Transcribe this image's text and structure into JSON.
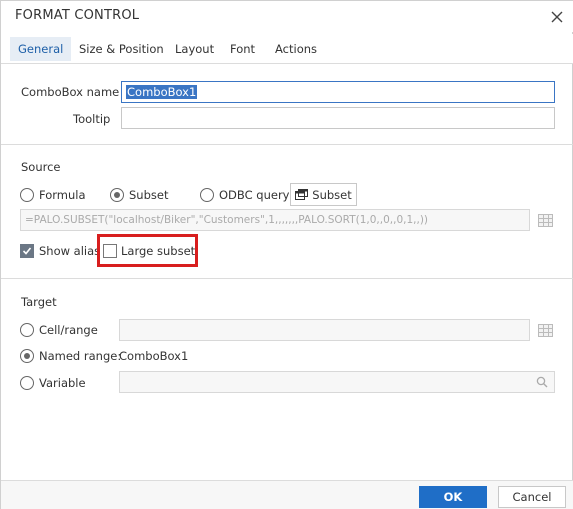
{
  "dialog": {
    "title": "FORMAT CONTROL",
    "close_icon": "close-icon"
  },
  "tabs": [
    {
      "label": "General",
      "active": true
    },
    {
      "label": "Size & Position",
      "active": false
    },
    {
      "label": "Layout",
      "active": false
    },
    {
      "label": "Font",
      "active": false
    },
    {
      "label": "Actions",
      "active": false
    }
  ],
  "general": {
    "combobox_name_label": "ComboBox name",
    "combobox_name_value": "ComboBox1",
    "tooltip_label": "Tooltip",
    "tooltip_value": ""
  },
  "source": {
    "heading": "Source",
    "formula_label": "Formula",
    "subset_label": "Subset",
    "odbc_label": "ODBC query",
    "selected": "Subset",
    "subset_button_label": "Subset",
    "formula_value": "=PALO.SUBSET(\"localhost/Biker\",\"Customers\",1,,,,,,,PALO.SORT(1,0,,0,,0,1,,))",
    "show_alias_label": "Show alias",
    "show_alias_checked": true,
    "large_subset_label": "Large subset",
    "large_subset_checked": false
  },
  "target": {
    "heading": "Target",
    "cell_range_label": "Cell/range",
    "named_range_label": "Named range:",
    "named_range_value": "ComboBox1",
    "variable_label": "Variable",
    "selected": "Named range"
  },
  "footer": {
    "ok_label": "OK",
    "cancel_label": "Cancel"
  },
  "colors": {
    "accent": "#1f6ec7",
    "tab_active_bg": "#e6edf5",
    "highlight": "#d81e1e"
  }
}
